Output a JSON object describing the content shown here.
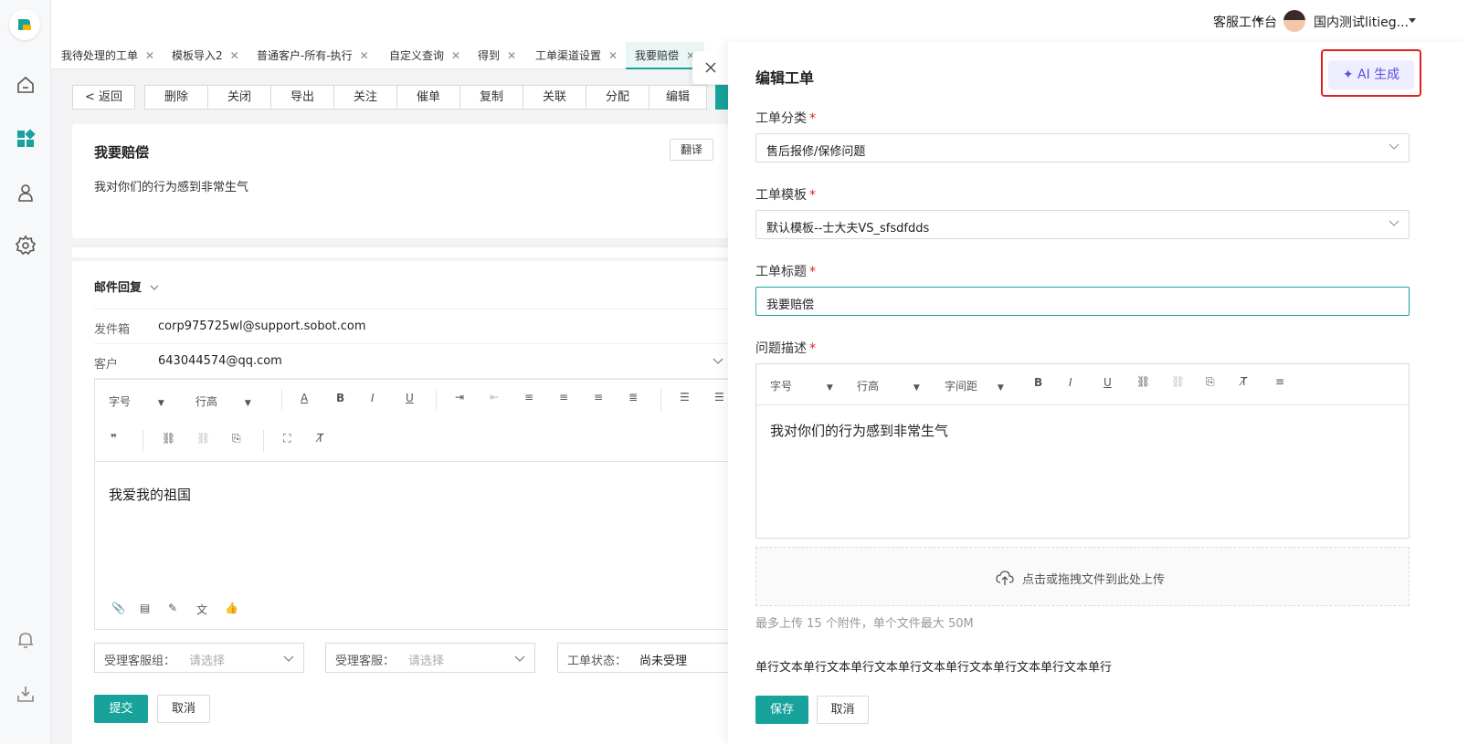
{
  "topbar": {
    "workspace": "客服工作台",
    "user": "国内测试litieg..."
  },
  "tabs": [
    {
      "label": "我待处理的工单"
    },
    {
      "label": "模板导入2"
    },
    {
      "label": "普通客户-所有-执行"
    },
    {
      "label": "自定义查询"
    },
    {
      "label": "得到"
    },
    {
      "label": "工单渠道设置"
    },
    {
      "label": "我要赔偿"
    }
  ],
  "toolbar": {
    "back": "返回",
    "actions": [
      "删除",
      "关闭",
      "导出",
      "关注",
      "催单",
      "复制",
      "关联",
      "分配",
      "编辑"
    ]
  },
  "ticket": {
    "title": "我要赔偿",
    "description": "我对你们的行为感到非常生气",
    "translate": "翻译"
  },
  "mail": {
    "header": "邮件回复",
    "sender_label": "发件箱",
    "sender": "corp975725wl@support.sobot.com",
    "customer_label": "客户",
    "customer": "643044574@qq.com",
    "font_size": "字号",
    "line_height": "行高",
    "body": "我爱我的祖国",
    "group_label": "受理客服组：",
    "group_ph": "请选择",
    "agent_label": "受理客服：",
    "agent_ph": "请选择",
    "status_label": "工单状态：",
    "status_val": "尚未受理",
    "submit": "提交",
    "cancel": "取消"
  },
  "drawer": {
    "title": "编辑工单",
    "ai": "AI 生成",
    "category_label": "工单分类",
    "category": "售后报修/保修问题",
    "template_label": "工单模板",
    "template": "默认模板--士大夫VS_sfsdfdds",
    "subject_label": "工单标题",
    "subject": "我要赔偿",
    "desc_label": "问题描述",
    "font_size": "字号",
    "line_height": "行高",
    "letter_spacing": "字间距",
    "desc": "我对你们的行为感到非常生气",
    "upload": "点击或拖拽文件到此处上传",
    "upload_hint": "最多上传 15 个附件，单个文件最大 50M",
    "single_line": "单行文本单行文本单行文本单行文本单行文本单行文本单行文本单行",
    "save": "保存",
    "cancel": "取消"
  },
  "colors": {
    "primary": "#17a39b",
    "ai": "#5a4fe0",
    "highlight": "#e02020"
  }
}
